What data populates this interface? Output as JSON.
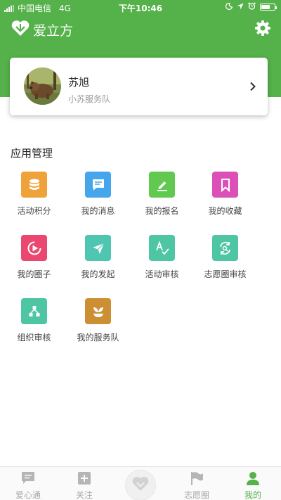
{
  "status_bar": {
    "carrier": "中国电信",
    "network": "4G",
    "time": "下午10:46"
  },
  "header": {
    "app_title": "爱立方",
    "logo_icon": "heart-logo-icon",
    "settings_icon": "gear-icon"
  },
  "profile": {
    "name": "苏旭",
    "team": "小苏服务队",
    "avatar": "bear-avatar"
  },
  "section": {
    "title": "应用管理"
  },
  "apps": [
    {
      "label": "活动积分",
      "icon": "database-icon",
      "color": "#f0a23a"
    },
    {
      "label": "我的消息",
      "icon": "message-icon",
      "color": "#46a6ec"
    },
    {
      "label": "我的报名",
      "icon": "edit-icon",
      "color": "#61c94f"
    },
    {
      "label": "我的收藏",
      "icon": "bookmark-icon",
      "color": "#dc4fb7"
    },
    {
      "label": "我的圈子",
      "icon": "play-circle-icon",
      "color": "#ea4771"
    },
    {
      "label": "我的发起",
      "icon": "paper-plane-icon",
      "color": "#4ec6b1"
    },
    {
      "label": "活动审核",
      "icon": "spellcheck-icon",
      "color": "#4ec6a3"
    },
    {
      "label": "志愿圈审核",
      "icon": "refresh-search-icon",
      "color": "#4ec6a3"
    },
    {
      "label": "组织审核",
      "icon": "organization-icon",
      "color": "#4ec6a3"
    },
    {
      "label": "我的服务队",
      "icon": "sprout-icon",
      "color": "#cd8f33"
    }
  ],
  "tabbar": {
    "tabs": [
      {
        "label": "爱心通",
        "icon": "chat-icon",
        "active": false
      },
      {
        "label": "关注",
        "icon": "plus-square-icon",
        "active": false
      },
      {
        "label": "",
        "icon": "heart-center-icon",
        "active": false
      },
      {
        "label": "志愿圈",
        "icon": "flag-icon",
        "active": false
      },
      {
        "label": "我的",
        "icon": "person-icon",
        "active": true
      }
    ]
  },
  "colors": {
    "brand_green": "#55b14a",
    "inactive_tab": "#a8a8a8"
  }
}
